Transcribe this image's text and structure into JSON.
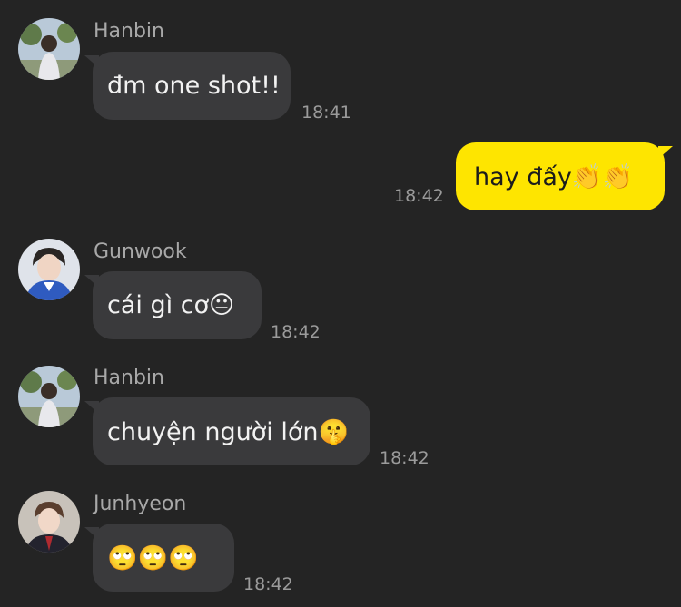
{
  "colors": {
    "background": "#242424",
    "incoming_bubble": "#3a3a3c",
    "outgoing_bubble": "#fee500",
    "sender_name": "#a8a8a8",
    "timestamp": "#9b9b9b"
  },
  "messages": [
    {
      "sender": "Hanbin",
      "avatar": "hanbin-avatar",
      "text": "đm one shot!!",
      "time": "18:41",
      "direction": "incoming"
    },
    {
      "sender": "",
      "avatar": "",
      "text": "hay đấy👏👏",
      "time": "18:42",
      "direction": "outgoing"
    },
    {
      "sender": "Gunwook",
      "avatar": "gunwook-avatar",
      "text": "cái gì cơ😐",
      "time": "18:42",
      "direction": "incoming"
    },
    {
      "sender": "Hanbin",
      "avatar": "hanbin-avatar",
      "text": "chuyện người lớn🤫",
      "time": "18:42",
      "direction": "incoming"
    },
    {
      "sender": "Junhyeon",
      "avatar": "junhyeon-avatar",
      "text": "🙄🙄🙄",
      "time": "18:42",
      "direction": "incoming"
    }
  ]
}
